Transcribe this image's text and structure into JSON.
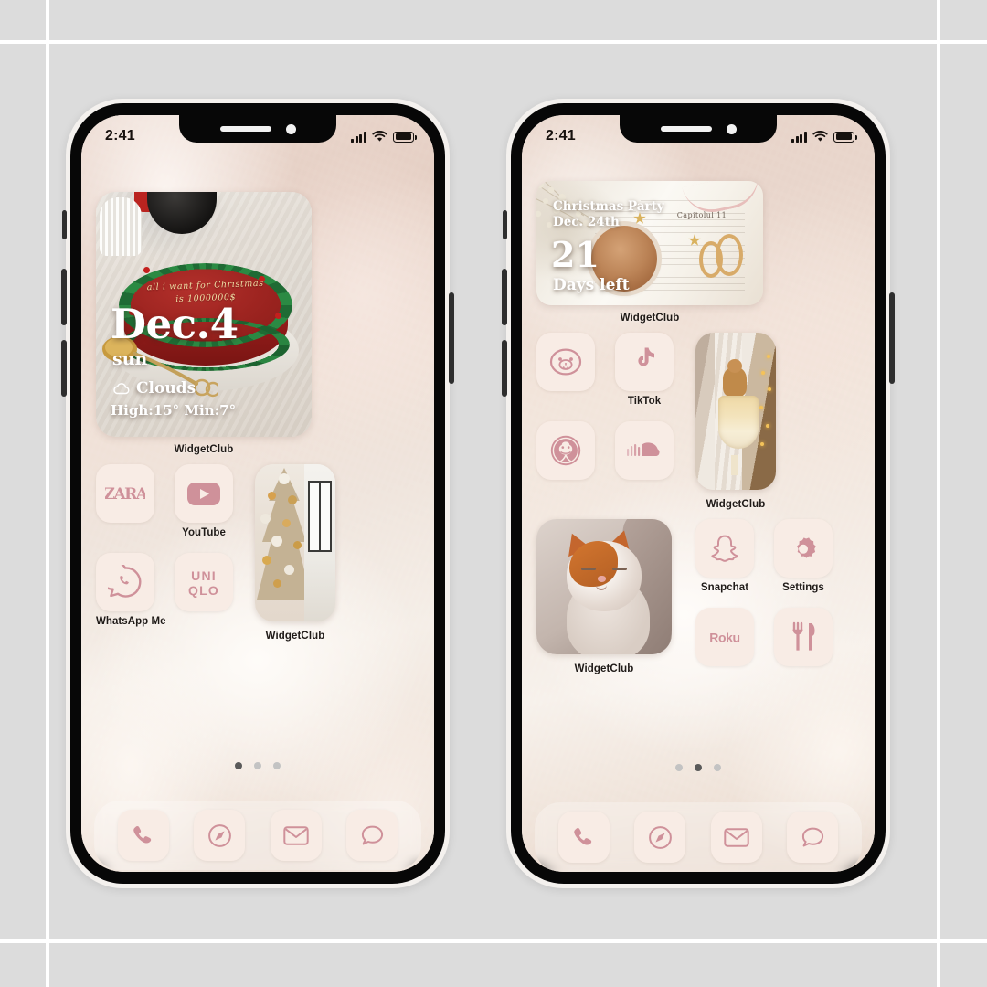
{
  "background": {
    "color": "#dcdcdc",
    "gridline_color": "#ffffff"
  },
  "theme": {
    "tile_bg": "#f8ece5",
    "icon_pink": "#cf919a",
    "label_color": "#1f1a17",
    "dot_active": "#5a5a5a",
    "dot_inactive": "#c3c3c3"
  },
  "phones": [
    {
      "name": "phone-left",
      "status_bar": {
        "time": "2:41",
        "signal": "cellular-bars-icon",
        "wifi": "wifi-icon",
        "battery": "battery-icon"
      },
      "widgets": {
        "calendar_weather": {
          "label": "WidgetClub",
          "date": "Dec.4",
          "weekday": "sun",
          "condition_icon": "cloud-icon",
          "condition": "Clouds",
          "temps": "High:15° Min:7°",
          "photo_text": "all i want for Christmas is 1000000$"
        },
        "photo_tree": {
          "label": "WidgetClub"
        }
      },
      "apps": [
        {
          "name": "ZARA",
          "label": "",
          "icon": "zara-icon"
        },
        {
          "name": "YouTube",
          "label": "YouTube",
          "icon": "youtube-icon"
        },
        {
          "name": "WhatsApp Me",
          "label": "WhatsApp Me",
          "icon": "whatsapp-icon"
        },
        {
          "name": "UNIQLO",
          "label": "",
          "icon": "uniqlo-icon"
        }
      ],
      "page_dots": {
        "count": 3,
        "active_index": 0
      },
      "dock": [
        {
          "name": "Phone",
          "icon": "phone-handset-icon"
        },
        {
          "name": "Safari",
          "icon": "compass-icon"
        },
        {
          "name": "Mail",
          "icon": "envelope-icon"
        },
        {
          "name": "Messages",
          "icon": "speech-bubble-icon"
        }
      ]
    },
    {
      "name": "phone-right",
      "status_bar": {
        "time": "2:41",
        "signal": "cellular-bars-icon",
        "wifi": "wifi-icon",
        "battery": "battery-icon"
      },
      "widgets": {
        "countdown": {
          "label": "WidgetClub",
          "title": "Christmas Party",
          "date": "Dec. 24th",
          "number": "21",
          "unit": "Days left",
          "book_chapter_text": "Capitolul 11"
        },
        "photo_dessert": {
          "label": "WidgetClub"
        },
        "photo_cat": {
          "label": "WidgetClub"
        }
      },
      "apps_top": [
        {
          "name": "LINE",
          "label": "",
          "icon": "bear-face-icon"
        },
        {
          "name": "TikTok",
          "label": "TikTok",
          "icon": "tiktok-icon"
        },
        {
          "name": "Starbucks",
          "label": "",
          "icon": "starbucks-icon"
        },
        {
          "name": "SoundCloud",
          "label": "",
          "icon": "soundcloud-icon"
        }
      ],
      "apps_bottom": [
        {
          "name": "Snapchat",
          "label": "Snapchat",
          "icon": "snapchat-ghost-icon"
        },
        {
          "name": "Settings",
          "label": "Settings",
          "icon": "gear-icon"
        },
        {
          "name": "Roku",
          "label": "",
          "icon": "roku-icon"
        },
        {
          "name": "Restaurant",
          "label": "",
          "icon": "fork-knife-icon"
        }
      ],
      "page_dots": {
        "count": 3,
        "active_index": 1
      },
      "dock": [
        {
          "name": "Phone",
          "icon": "phone-handset-icon"
        },
        {
          "name": "Safari",
          "icon": "compass-icon"
        },
        {
          "name": "Mail",
          "icon": "envelope-icon"
        },
        {
          "name": "Messages",
          "icon": "speech-bubble-icon"
        }
      ]
    }
  ]
}
